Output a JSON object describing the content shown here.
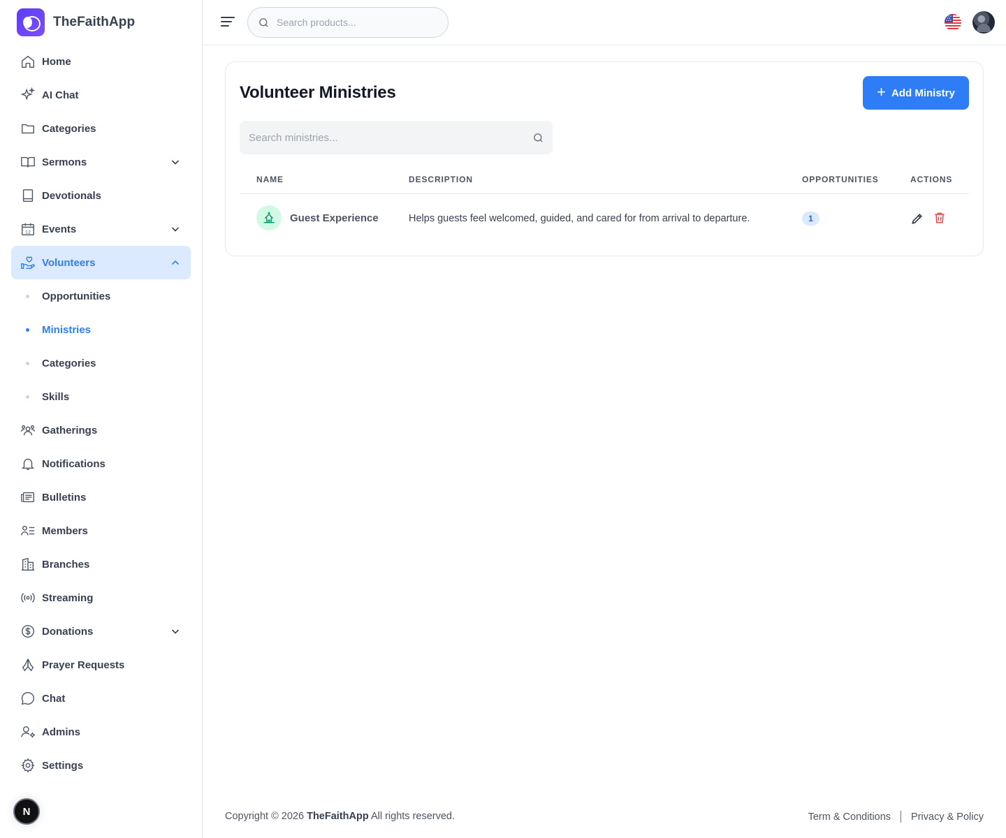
{
  "brand": {
    "name": "TheFaithApp"
  },
  "sidebar": {
    "items": [
      {
        "label": "Home",
        "icon": "home-icon"
      },
      {
        "label": "AI Chat",
        "icon": "sparkles-icon"
      },
      {
        "label": "Categories",
        "icon": "folder-icon"
      },
      {
        "label": "Sermons",
        "icon": "book-open-icon",
        "expandable": true
      },
      {
        "label": "Devotionals",
        "icon": "book-icon"
      },
      {
        "label": "Events",
        "icon": "calendar-icon",
        "expandable": true
      },
      {
        "label": "Volunteers",
        "icon": "hand-heart-icon",
        "expandable": true,
        "expanded": true,
        "active": true,
        "children": [
          {
            "label": "Opportunities"
          },
          {
            "label": "Ministries",
            "active": true
          },
          {
            "label": "Categories"
          },
          {
            "label": "Skills"
          }
        ]
      },
      {
        "label": "Gatherings",
        "icon": "users-icon"
      },
      {
        "label": "Notifications",
        "icon": "bell-icon"
      },
      {
        "label": "Bulletins",
        "icon": "newspaper-icon"
      },
      {
        "label": "Members",
        "icon": "user-list-icon"
      },
      {
        "label": "Branches",
        "icon": "building-icon"
      },
      {
        "label": "Streaming",
        "icon": "broadcast-icon"
      },
      {
        "label": "Donations",
        "icon": "dollar-icon",
        "expandable": true
      },
      {
        "label": "Prayer Requests",
        "icon": "praying-hands-icon"
      },
      {
        "label": "Chat",
        "icon": "chat-bubble-icon"
      },
      {
        "label": "Admins",
        "icon": "user-gear-icon"
      },
      {
        "label": "Settings",
        "icon": "gear-icon"
      }
    ],
    "bottom_badge": "N"
  },
  "header": {
    "search_placeholder": "Search products...",
    "language_flag": "us-flag-icon"
  },
  "main": {
    "title": "Volunteer Ministries",
    "add_button_label": "Add Ministry",
    "search_placeholder": "Search ministries...",
    "columns": [
      "NAME",
      "DESCRIPTION",
      "OPPORTUNITIES",
      "ACTIONS"
    ],
    "rows": [
      {
        "name": "Guest Experience",
        "icon": "church-icon",
        "description": "Helps guests feel welcomed, guided, and cared for from arrival to departure.",
        "opportunities": "1"
      }
    ]
  },
  "footer": {
    "copyright_prefix": "Copyright © 2026",
    "brand": "TheFaithApp",
    "copyright_suffix": "All rights reserved.",
    "terms": "Term & Conditions",
    "privacy": "Privacy & Policy"
  },
  "colors": {
    "accent": "#2f7df6",
    "brand_purple": "#5b3df5",
    "active_bg": "#dbeafe",
    "danger": "#ef4444",
    "icon_green": "#059669"
  }
}
